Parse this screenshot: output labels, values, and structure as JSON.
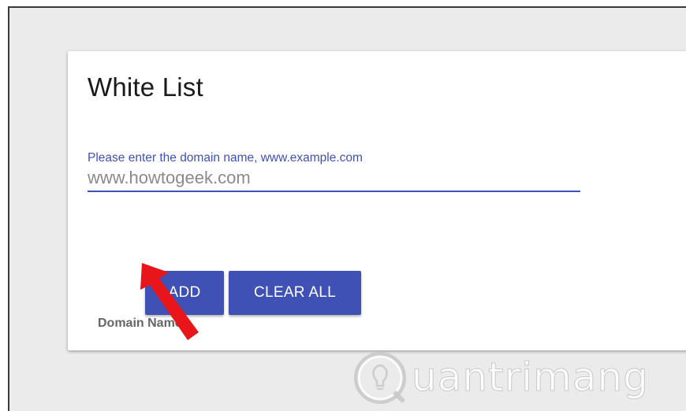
{
  "card": {
    "title": "White List"
  },
  "domain_field": {
    "label": "Please enter the domain name, www.example.com",
    "value": "www.howtogeek.com"
  },
  "buttons": {
    "add_label": "ADD",
    "clear_all_label": "CLEAR ALL"
  },
  "table": {
    "column_header": "Domain Name"
  },
  "annotation": {
    "arrow_color": "#e8151b"
  },
  "watermark": {
    "text": "uantrimang",
    "icon": "lightbulb-q-icon"
  },
  "colors": {
    "accent": "#3f51b5",
    "background": "#ebebeb",
    "card": "#ffffff"
  }
}
